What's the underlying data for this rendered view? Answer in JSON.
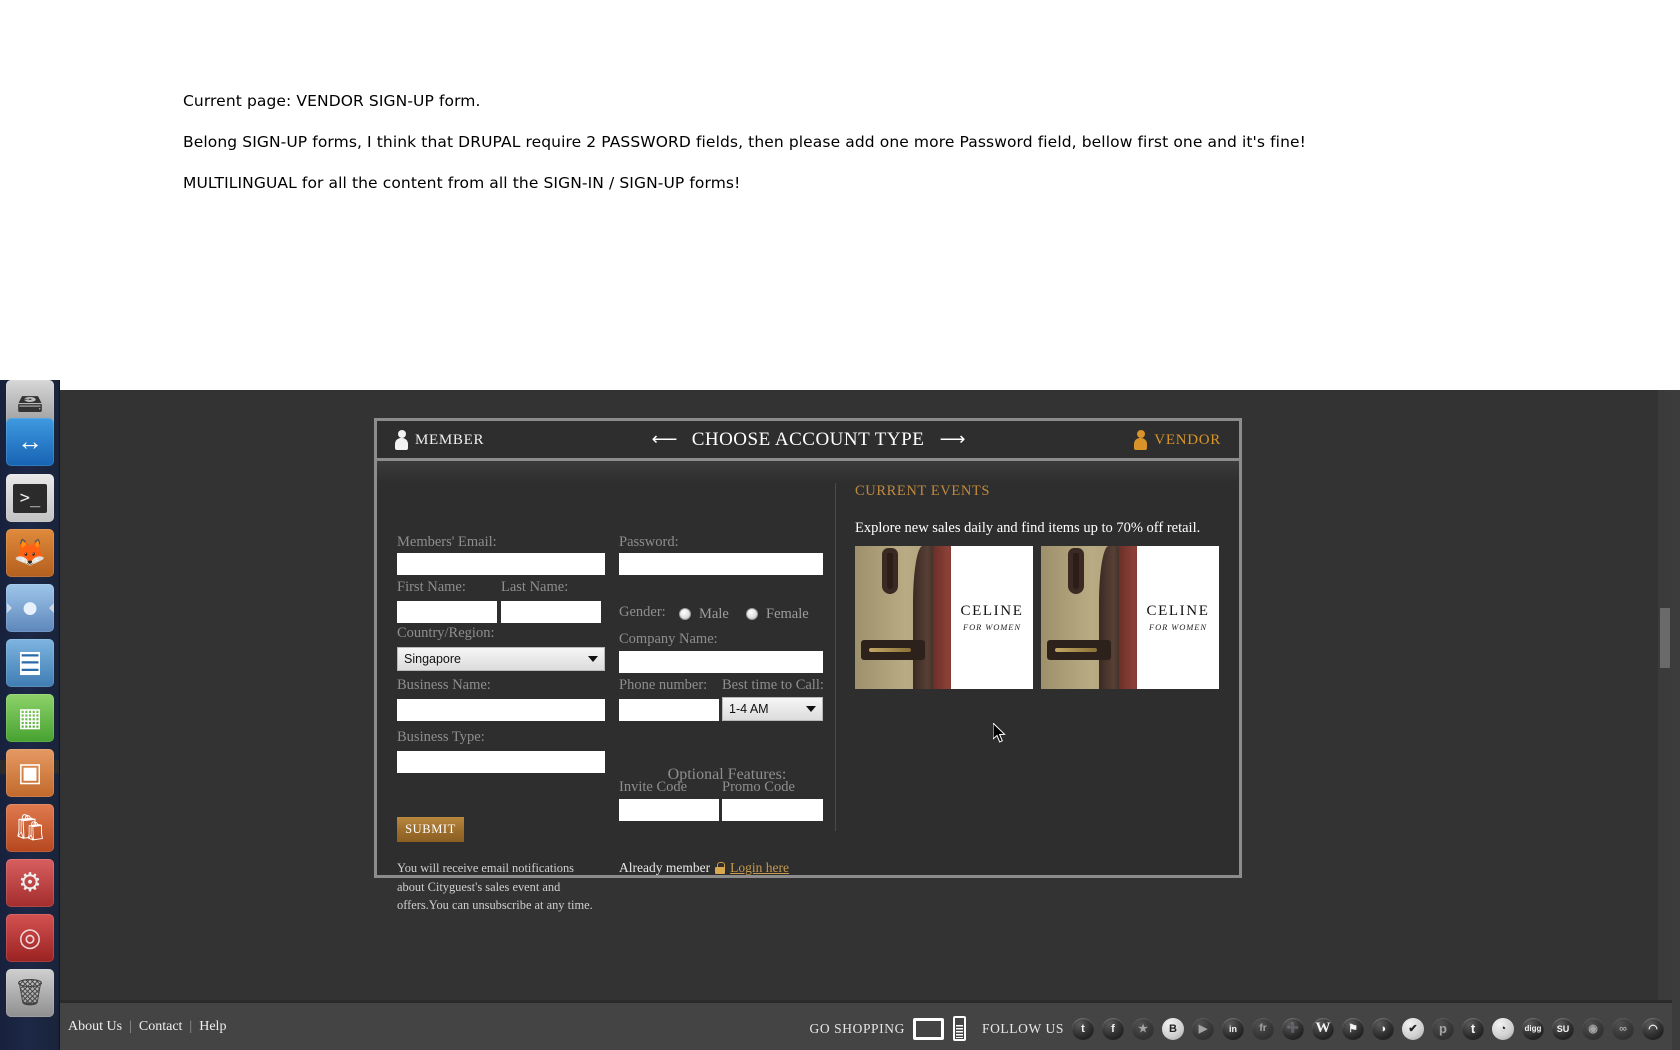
{
  "notes": {
    "line1": "Current page: VENDOR SIGN-UP form.",
    "line2": "Belong SIGN-UP forms, I think that DRUPAL require 2 PASSWORD fields, then please add one more Password field, bellow first one and it's fine!",
    "line3": "MULTILINGUAL for all the content from all the SIGN-IN / SIGN-UP forms!"
  },
  "launcher": {
    "items": [
      {
        "name": "files-icon",
        "glyph": "🖴"
      },
      {
        "name": "teamviewer-icon",
        "glyph": "↔"
      },
      {
        "name": "terminal-icon",
        "glyph": ">_"
      },
      {
        "name": "firefox-icon",
        "glyph": "🦊"
      },
      {
        "name": "chromium-icon",
        "glyph": "●"
      },
      {
        "name": "libreoffice-writer-icon",
        "glyph": "☰"
      },
      {
        "name": "libreoffice-calc-icon",
        "glyph": "▦"
      },
      {
        "name": "libreoffice-impress-icon",
        "glyph": "▣"
      },
      {
        "name": "ubuntu-software-center-icon",
        "glyph": "🛍"
      },
      {
        "name": "system-settings-icon",
        "glyph": "⚙"
      },
      {
        "name": "disk-tool-icon",
        "glyph": "◎"
      },
      {
        "name": "trash-icon",
        "glyph": "🗑"
      }
    ]
  },
  "panel": {
    "header": {
      "member_label": "MEMBER",
      "title": "CHOOSE ACCOUNT TYPE",
      "arrow_left": "⟵",
      "arrow_right": "⟶",
      "vendor_label": "VENDOR"
    },
    "form": {
      "email_label": "Members' Email:",
      "email_value": "",
      "password_label": "Password:",
      "password_value": "",
      "first_name_label": "First Name:",
      "first_name_value": "",
      "last_name_label": "Last Name:",
      "last_name_value": "",
      "gender_label": "Gender:",
      "gender_male": "Male",
      "gender_female": "Female",
      "country_label": "Country/Region:",
      "country_value": "Singapore",
      "company_label": "Company Name:",
      "company_value": "",
      "business_name_label": "Business Name:",
      "business_name_value": "",
      "phone_label": "Phone number:",
      "phone_value": "",
      "best_time_label": "Best time to Call:",
      "best_time_value": "1-4 AM",
      "business_type_label": "Business Type:",
      "business_type_value": "",
      "optional_features_label": "Optional Features:",
      "invite_code_label": "Invite Code",
      "invite_code_value": "",
      "promo_code_label": "Promo Code",
      "promo_code_value": "",
      "submit_label": "SUBMIT",
      "disclaimer": "You will receive email notifications about Cityguest's sales event and offers.You can unsubscribe at any time.",
      "already_member_text": "Already member",
      "login_link_label": "Login here"
    },
    "events": {
      "title": "CURRENT EVENTS",
      "subtitle": "Explore new sales daily and find items up to 70% off retail.",
      "items": [
        {
          "brand": "CELINE",
          "sub": "FOR WOMEN"
        },
        {
          "brand": "CELINE",
          "sub": "FOR WOMEN"
        }
      ]
    }
  },
  "footer": {
    "links": [
      "About Us",
      "Contact",
      "Help"
    ],
    "separator": "|",
    "go_shopping": "GO SHOPPING",
    "follow_us": "FOLLOW US",
    "social": [
      {
        "name": "twitter-icon",
        "glyph": "t"
      },
      {
        "name": "facebook-icon",
        "glyph": "f"
      },
      {
        "name": "orkut-icon",
        "glyph": "★"
      },
      {
        "name": "blogger-icon",
        "glyph": "B"
      },
      {
        "name": "youtube-icon",
        "glyph": "▶"
      },
      {
        "name": "linkedin-icon",
        "glyph": "in"
      },
      {
        "name": "friendfeed-icon",
        "glyph": "fr"
      },
      {
        "name": "plus-icon",
        "glyph": "➕"
      },
      {
        "name": "wordpress-icon",
        "glyph": "W"
      },
      {
        "name": "newsvine-icon",
        "glyph": "⚑"
      },
      {
        "name": "drupal-icon",
        "glyph": "◑"
      },
      {
        "name": "delicious-icon",
        "glyph": "✔"
      },
      {
        "name": "posterous-icon",
        "glyph": "p"
      },
      {
        "name": "tumblr-icon",
        "glyph": "t"
      },
      {
        "name": "flickr-icon",
        "glyph": "◔"
      },
      {
        "name": "digg-icon",
        "glyph": "digg"
      },
      {
        "name": "stumbleupon-icon",
        "glyph": "SU"
      },
      {
        "name": "reddit-icon",
        "glyph": "◉"
      },
      {
        "name": "technorati-icon",
        "glyph": "∞"
      },
      {
        "name": "rss-icon",
        "glyph": "◠"
      }
    ]
  },
  "colors": {
    "accent_gold": "#c08a3e",
    "panel_bg": "#2e2e2e",
    "page_bg": "#333333",
    "footer_bg": "#444444"
  }
}
